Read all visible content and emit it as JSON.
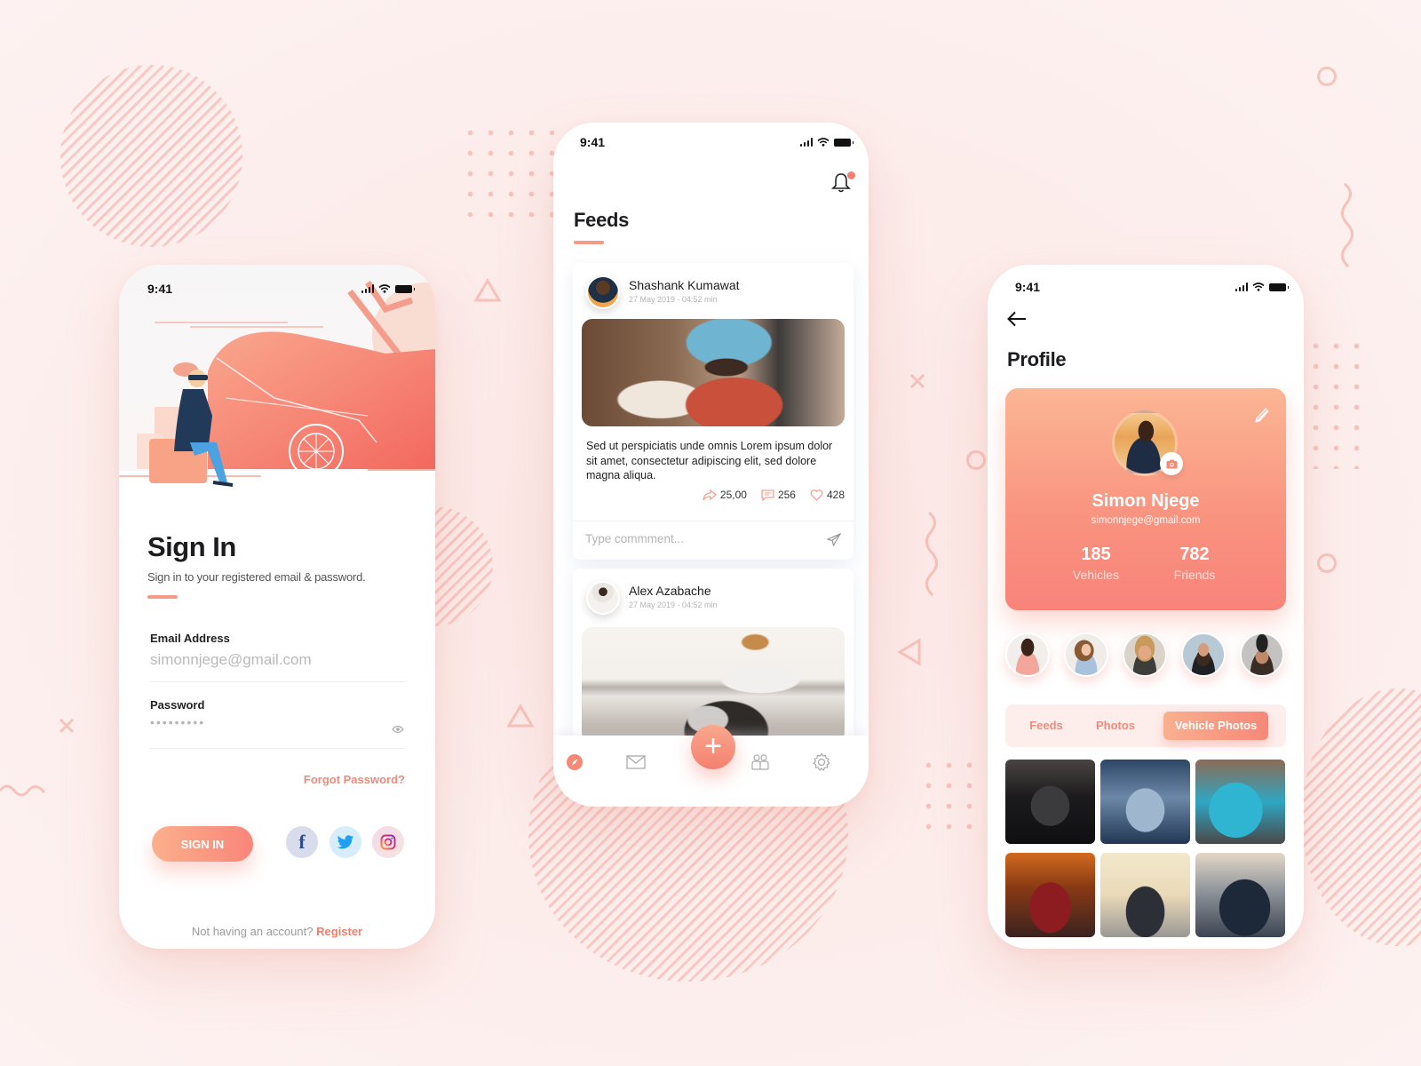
{
  "theme": {
    "accent": "#f48070",
    "accent_light": "#fbb08c",
    "background": "#fcebe9"
  },
  "signin_screen": {
    "status_time": "9:41",
    "title": "Sign In",
    "subtitle": "Sign in to your registered email & password.",
    "email_label": "Email Address",
    "email_value": "simonnjege@gmail.com",
    "password_label": "Password",
    "password_masked": "•••••••••",
    "forgot_password": "Forgot Password?",
    "signin_button": "SIGN IN",
    "social": [
      {
        "name": "facebook",
        "icon": "facebook-icon",
        "glyph": "f"
      },
      {
        "name": "twitter",
        "icon": "twitter-icon"
      },
      {
        "name": "instagram",
        "icon": "instagram-icon"
      }
    ],
    "register_prompt": "Not having an account?",
    "register_link": "Register"
  },
  "feeds_screen": {
    "status_time": "9:41",
    "title": "Feeds",
    "notification_count": 1,
    "posts": [
      {
        "author": "Shashank Kumawat",
        "time": "27 May 2019 - 04:52 min",
        "text": "Sed ut perspiciatis unde omnis Lorem ipsum dolor sit amet, consectetur adipiscing elit, sed dolore magna aliqua.",
        "shares": "25,00",
        "comments": "256",
        "likes": "428",
        "comment_placeholder": "Type commment..."
      },
      {
        "author": "Alex Azabache",
        "time": "27 May 2019 - 04:52 min"
      }
    ],
    "tabbar": [
      {
        "name": "explore",
        "icon": "compass-icon",
        "active": true
      },
      {
        "name": "messages",
        "icon": "mail-icon"
      },
      {
        "name": "add",
        "icon": "plus-icon",
        "glyph": "+"
      },
      {
        "name": "friends",
        "icon": "people-icon"
      },
      {
        "name": "settings",
        "icon": "gear-icon"
      }
    ]
  },
  "profile_screen": {
    "status_time": "9:41",
    "title": "Profile",
    "name": "Simon Njege",
    "email": "simonnjege@gmail.com",
    "stats": [
      {
        "value": "185",
        "label": "Vehicles"
      },
      {
        "value": "782",
        "label": "Friends"
      }
    ],
    "friends_count_shown": 5,
    "tabs": [
      {
        "label": "Feeds",
        "active": false
      },
      {
        "label": "Photos",
        "active": false
      },
      {
        "label": "Vehicle Photos",
        "active": true
      }
    ],
    "vehicle_photos_count_shown": 6
  }
}
